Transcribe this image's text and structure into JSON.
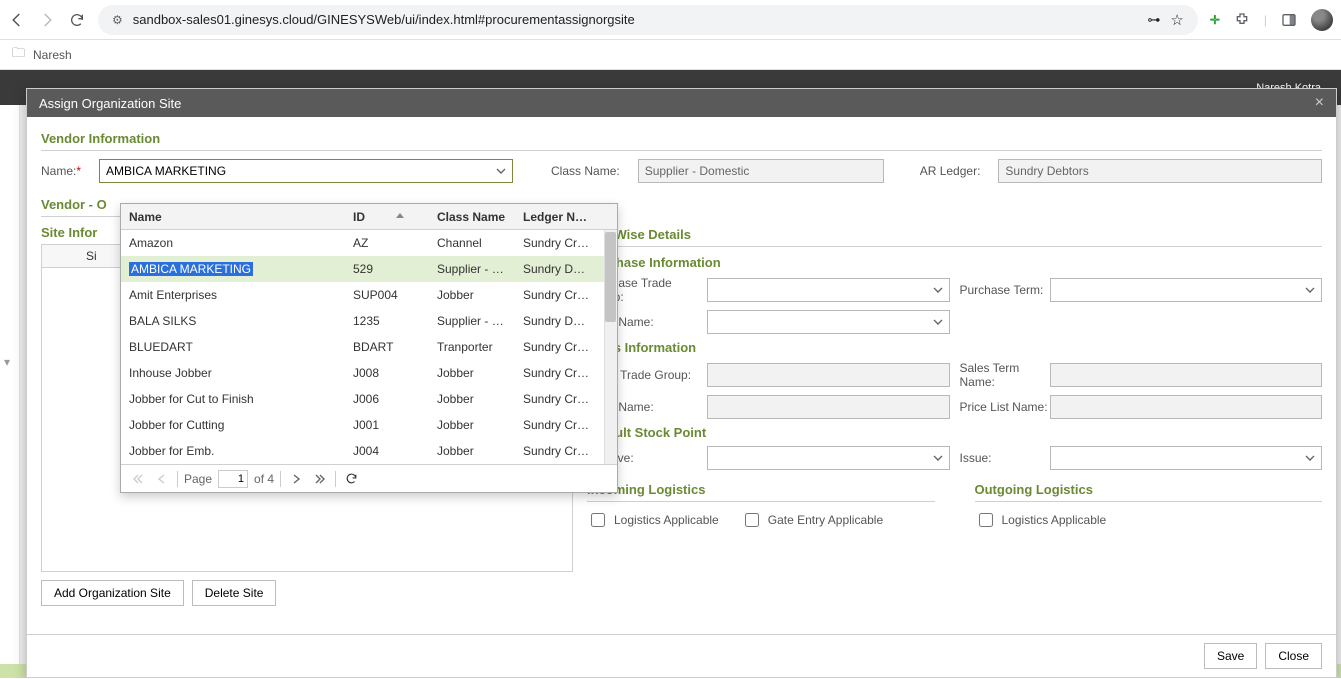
{
  "browser": {
    "url": "sandbox-sales01.ginesys.cloud/GINESYSWeb/ui/index.html#procurementassignorgsite",
    "bookmark_folder": "Naresh"
  },
  "app": {
    "topbar_user": "Naresh Kotra"
  },
  "modal": {
    "title": "Assign Organization Site",
    "sections": {
      "vendor_info": "Vendor Information",
      "vendor_org": "Vendor - O",
      "site_info": "Site Infor",
      "site_wise": "Site Wise Details",
      "purchase_info": "Purchase Information",
      "sales_info": "Sales Information",
      "default_stock": "Default Stock Point",
      "incoming_log": "Incoming Logistics",
      "outgoing_log": "Outgoing Logistics"
    },
    "labels": {
      "name": "Name:",
      "class_name": "Class Name:",
      "ar_ledger": "AR Ledger:",
      "site_col": "Si",
      "purchase_trade_group": "Purchase Trade Group:",
      "purchase_term": "Purchase Term:",
      "form_name_p": "Form Name:",
      "sales_trade_group": "Sales Trade Group:",
      "sales_term_name": "Sales Term Name:",
      "form_name_s": "Form Name:",
      "price_list_name": "Price List Name:",
      "receive": "Receive:",
      "issue": "Issue:",
      "logistics_applicable": "Logistics Applicable",
      "gate_entry_applicable": "Gate Entry Applicable"
    },
    "values": {
      "name": "AMBICA MARKETING",
      "class_name": "Supplier - Domestic",
      "ar_ledger": "Sundry Debtors"
    },
    "buttons": {
      "add_org_site": "Add Organization Site",
      "delete_site": "Delete Site",
      "save": "Save",
      "close": "Close"
    }
  },
  "dropdown": {
    "headers": {
      "name": "Name",
      "id": "ID",
      "class": "Class Name",
      "ledger": "Ledger Name"
    },
    "rows": [
      {
        "name": "Amazon",
        "id": "AZ",
        "class": "Channel",
        "ledger": "Sundry Credit..."
      },
      {
        "name": "AMBICA MARKETING",
        "id": "529",
        "class": "Supplier - Do...",
        "ledger": "Sundry Debtors",
        "selected": true
      },
      {
        "name": "Amit Enterprises",
        "id": "SUP004",
        "class": "Jobber",
        "ledger": "Sundry Credit..."
      },
      {
        "name": "BALA SILKS",
        "id": "1235",
        "class": "Supplier - Do...",
        "ledger": "Sundry Debtors"
      },
      {
        "name": "BLUEDART",
        "id": "BDART",
        "class": "Tranporter",
        "ledger": "Sundry Credit..."
      },
      {
        "name": "Inhouse Jobber",
        "id": "J008",
        "class": "Jobber",
        "ledger": "Sundry Credit..."
      },
      {
        "name": "Jobber for Cut to Finish",
        "id": "J006",
        "class": "Jobber",
        "ledger": "Sundry Credit..."
      },
      {
        "name": "Jobber for Cutting",
        "id": "J001",
        "class": "Jobber",
        "ledger": "Sundry Credit..."
      },
      {
        "name": "Jobber for Emb.",
        "id": "J004",
        "class": "Jobber",
        "ledger": "Sundry Credit..."
      }
    ],
    "pager": {
      "label_page": "Page",
      "current": "1",
      "of": "of 4"
    }
  }
}
